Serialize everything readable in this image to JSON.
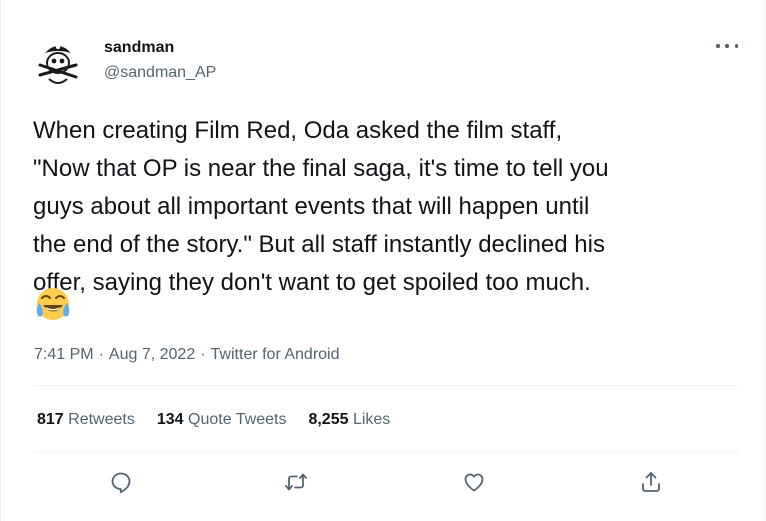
{
  "author": {
    "name": "sandman",
    "handle": "@sandman_AP",
    "avatar_icon": "pirate-skull-avatar"
  },
  "tweet": {
    "text": "When creating Film Red, Oda asked the film staff,\n\"Now that OP is near the final saga, it's time to tell you\nguys about all important events that will happen until\nthe end of the story.\" But all staff instantly declined his\noffer, saying they don't want to get spoiled too much.",
    "emoji": "😂",
    "time": "7:41 PM",
    "date": "Aug 7, 2022",
    "source": "Twitter for Android"
  },
  "stats": {
    "retweets_count": "817",
    "retweets_label": "Retweets",
    "quotes_count": "134",
    "quotes_label": "Quote Tweets",
    "likes_count": "8,255",
    "likes_label": "Likes"
  },
  "actions": [
    "reply-icon",
    "retweet-icon",
    "like-icon",
    "share-icon"
  ],
  "colors": {
    "text": "#0f1419",
    "secondary": "#536471",
    "divider": "#eff3f4"
  }
}
